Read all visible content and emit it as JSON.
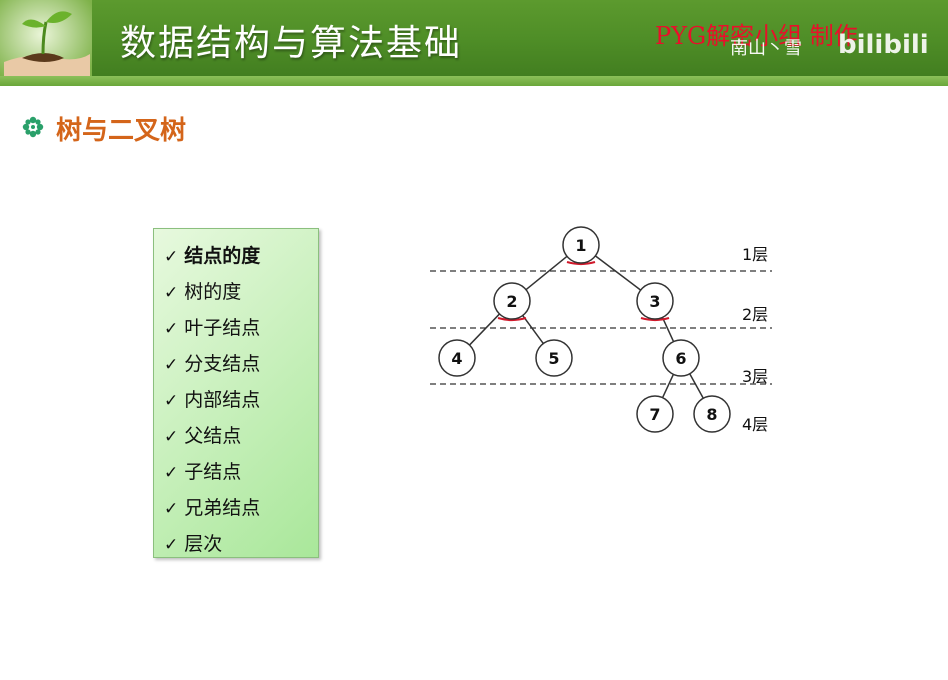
{
  "header": {
    "title": "数据结构与算法基础",
    "credit": "PYG解密小组 制作",
    "watermark_user": "南山丶雪",
    "watermark_logo": "bilibili",
    "logo_icon": "seedling-in-hands-icon"
  },
  "section": {
    "bullet_icon": "flower-bullet-icon",
    "heading": "树与二叉树"
  },
  "terms": [
    {
      "label": "结点的度",
      "bold": true
    },
    {
      "label": "树的度",
      "bold": false
    },
    {
      "label": "叶子结点",
      "bold": false
    },
    {
      "label": "分支结点",
      "bold": false
    },
    {
      "label": "内部结点",
      "bold": false
    },
    {
      "label": "父结点",
      "bold": false
    },
    {
      "label": "子结点",
      "bold": false
    },
    {
      "label": "兄弟结点",
      "bold": false
    },
    {
      "label": "层次",
      "bold": false
    }
  ],
  "tree": {
    "nodes": [
      {
        "id": "1",
        "level": 1
      },
      {
        "id": "2",
        "level": 2
      },
      {
        "id": "3",
        "level": 2
      },
      {
        "id": "4",
        "level": 3
      },
      {
        "id": "5",
        "level": 3
      },
      {
        "id": "6",
        "level": 3
      },
      {
        "id": "7",
        "level": 4
      },
      {
        "id": "8",
        "level": 4
      }
    ],
    "edges": [
      [
        "1",
        "2"
      ],
      [
        "1",
        "3"
      ],
      [
        "2",
        "4"
      ],
      [
        "2",
        "5"
      ],
      [
        "3",
        "6"
      ],
      [
        "6",
        "7"
      ],
      [
        "6",
        "8"
      ]
    ],
    "underlined_nodes": [
      "1",
      "2",
      "3"
    ],
    "level_labels": [
      "1层",
      "2层",
      "3层",
      "4层"
    ],
    "colors": {
      "underline": "#d0182a",
      "node_stroke": "#333333"
    }
  }
}
